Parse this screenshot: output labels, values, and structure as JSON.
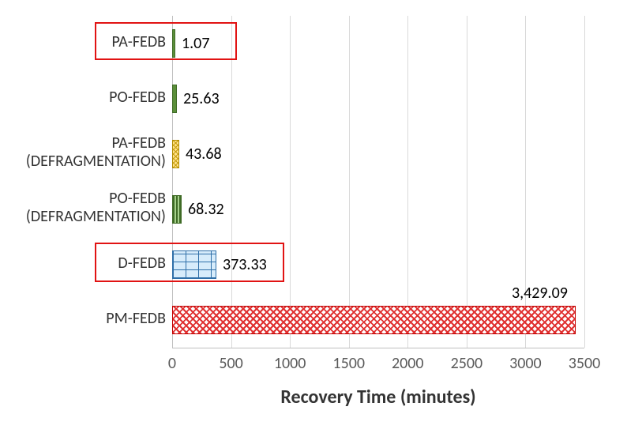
{
  "chart_data": {
    "type": "bar",
    "orientation": "horizontal",
    "xlabel": "Recovery Time (minutes)",
    "ylabel": "",
    "xlim": [
      0,
      3500
    ],
    "xticks": [
      0,
      500,
      1000,
      1500,
      2000,
      2500,
      3000,
      3500
    ],
    "categories": [
      "PA-FEDB",
      "PO-FEDB",
      "PA-FEDB (DEFRAGMENTATION)",
      "PO-FEDB (DEFRAGMENTATION)",
      "D-FEDB",
      "PM-FEDB"
    ],
    "values": [
      1.07,
      25.63,
      43.68,
      68.32,
      373.33,
      3429.09
    ],
    "value_labels": [
      "1.07",
      "25.63",
      "43.68",
      "68.32",
      "373.33",
      "3,429.09"
    ],
    "highlighted": [
      "PA-FEDB",
      "D-FEDB"
    ],
    "bar_styles": [
      "green-solid",
      "green-solid",
      "yellow-hatch",
      "green-hatch",
      "blue-brick",
      "red-checker"
    ]
  },
  "labels": {
    "cat0_l1": "PA-FEDB",
    "cat1_l1": "PO-FEDB",
    "cat2_l1": "PA-FEDB",
    "cat2_l2": "(DEFRAGMENTATION)",
    "cat3_l1": "PO-FEDB",
    "cat3_l2": "(DEFRAGMENTATION)",
    "cat4_l1": "D-FEDB",
    "cat5_l1": "PM-FEDB"
  },
  "ticks": {
    "t0": "0",
    "t1": "500",
    "t2": "1000",
    "t3": "1500",
    "t4": "2000",
    "t5": "2500",
    "t6": "3000",
    "t7": "3500"
  },
  "vlabels": {
    "v0": "1.07",
    "v1": "25.63",
    "v2": "43.68",
    "v3": "68.32",
    "v4": "373.33",
    "v5": "3,429.09"
  },
  "xlabel": "Recovery Time (minutes)"
}
